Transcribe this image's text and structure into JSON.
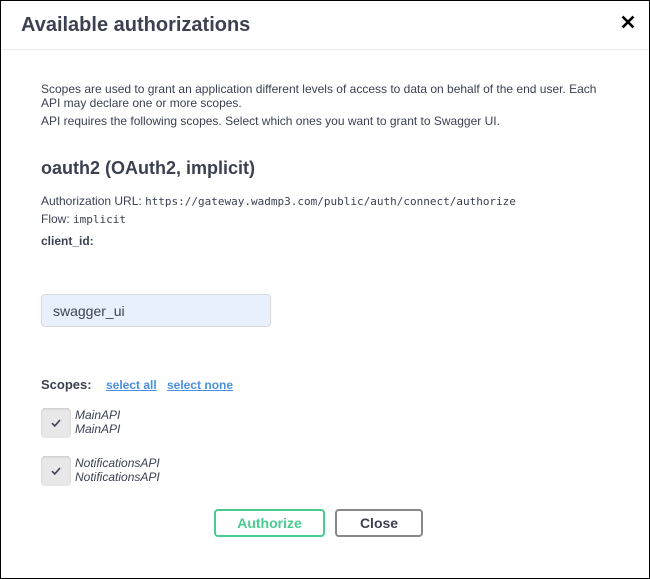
{
  "modal": {
    "title": "Available authorizations",
    "close_icon": "close-x-icon"
  },
  "description": {
    "line1": "Scopes are used to grant an application different levels of access to data on behalf of the end user. Each API may declare one or more scopes.",
    "line2": "API requires the following scopes. Select which ones you want to grant to Swagger UI."
  },
  "scheme": {
    "title": "oauth2 (OAuth2, implicit)",
    "auth_url_label": "Authorization URL:",
    "auth_url": "https://gateway.wadmp3.com/public/auth/connect/authorize",
    "flow_label": "Flow:",
    "flow": "implicit",
    "client_id_label": "client_id:",
    "client_id_value": "swagger_ui"
  },
  "scopes": {
    "label": "Scopes:",
    "select_all": "select all",
    "select_none": "select none",
    "items": [
      {
        "name": "MainAPI",
        "description": "MainAPI",
        "checked": true
      },
      {
        "name": "NotificationsAPI",
        "description": "NotificationsAPI",
        "checked": true
      }
    ]
  },
  "buttons": {
    "authorize": "Authorize",
    "close": "Close"
  },
  "colors": {
    "authorize_green": "#49cc90",
    "link_blue": "#4990e2",
    "text": "#3b4151",
    "input_bg": "#e8f0fe"
  }
}
